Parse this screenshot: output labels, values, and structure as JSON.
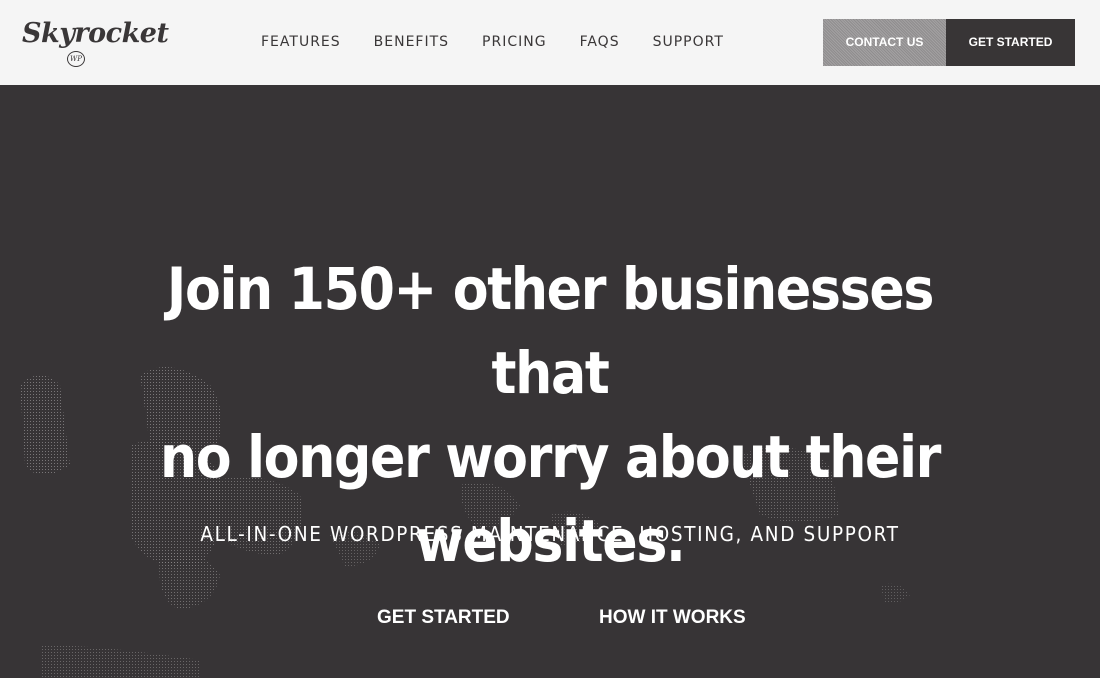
{
  "logo": {
    "text": "Skyrocket",
    "badge": "WP"
  },
  "nav": {
    "items": [
      {
        "label": "FEATURES"
      },
      {
        "label": "BENEFITS"
      },
      {
        "label": "PRICING"
      },
      {
        "label": "FAQS"
      },
      {
        "label": "SUPPORT"
      }
    ]
  },
  "header_buttons": {
    "contact_label": "CONTACT US",
    "get_started_label": "GET STARTED"
  },
  "hero": {
    "headline_line1": "Join 150+ other businesses that",
    "headline_line2": "no longer worry about their",
    "headline_line3": "websites.",
    "subheadline": "ALL-IN-ONE WORDPRESS MAINTENANCE, HOSTING, AND SUPPORT",
    "cta_primary": "GET STARTED",
    "cta_secondary": "HOW IT WORKS"
  },
  "colors": {
    "header_bg": "#f5f5f5",
    "hero_bg": "#373436",
    "dark_button": "#383536",
    "contact_button": "#9a9899",
    "text_light": "#ffffff"
  }
}
